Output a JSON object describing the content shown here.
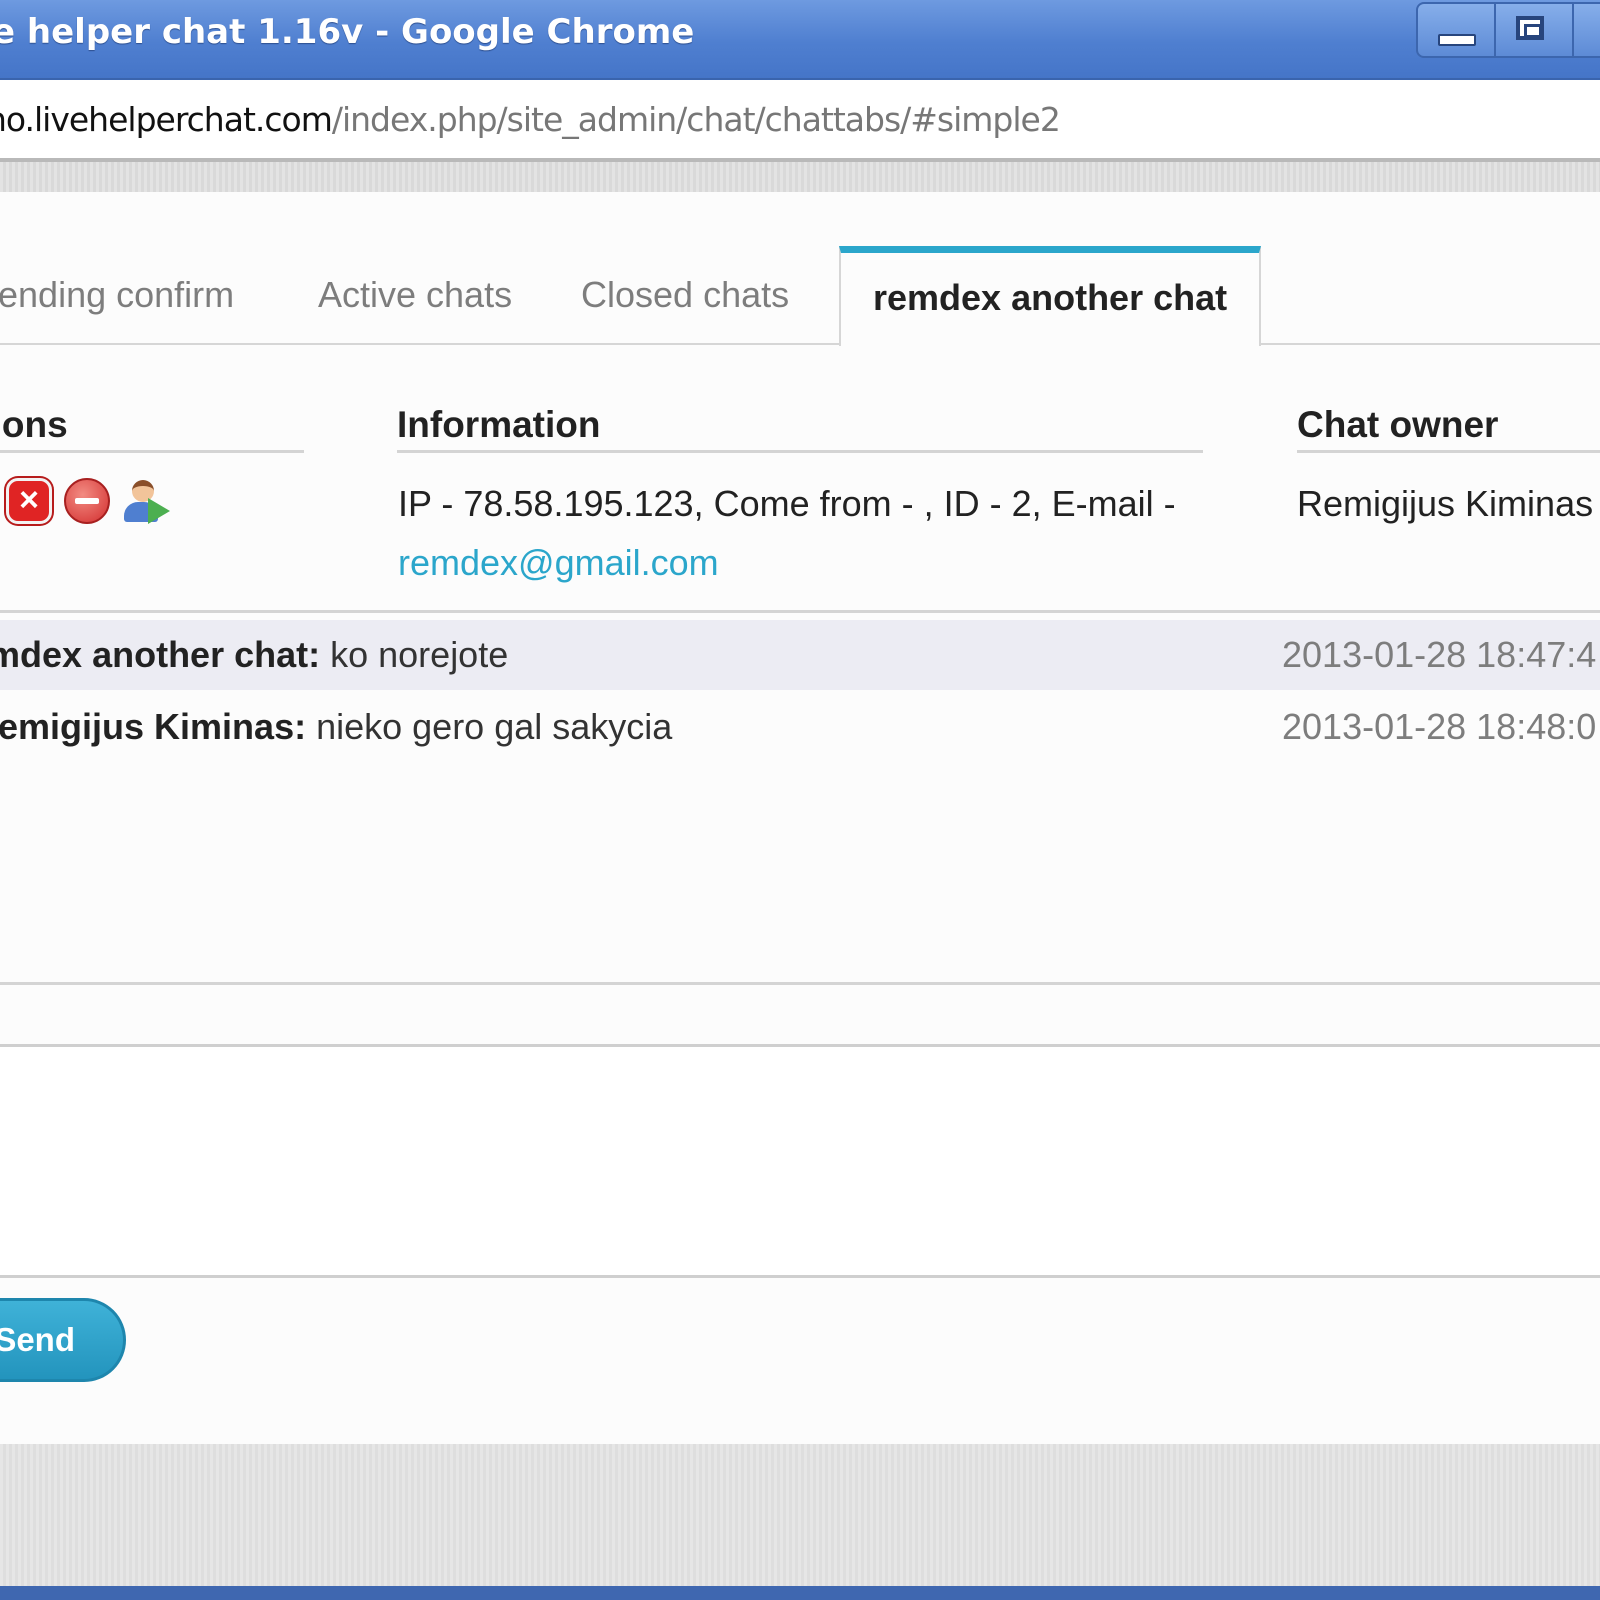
{
  "window": {
    "title": "e helper chat 1.16v - Google Chrome"
  },
  "address_bar": {
    "host": "no.livehelperchat.com",
    "path": "/index.php/site_admin/chat/chattabs/#simple2"
  },
  "tabs": [
    {
      "label": "Pending confirm",
      "active": false
    },
    {
      "label": "Active chats",
      "active": false
    },
    {
      "label": "Closed chats",
      "active": false
    },
    {
      "label": "remdex another chat",
      "active": true
    }
  ],
  "columns": {
    "actions": "Actions",
    "information": "Information",
    "owner": "Chat owner"
  },
  "chat_info": {
    "action_icons": [
      "close-chat-icon",
      "block-user-icon",
      "transfer-chat-icon"
    ],
    "info_prefix": "IP - 78.58.195.123, Come from - , ID - 2, E-mail -",
    "email": "remdex@gmail.com",
    "owner": "Remigijus Kiminas"
  },
  "messages": [
    {
      "author": "remdex another chat:",
      "text": " ko norejote",
      "time": "2013-01-28 18:47:4"
    },
    {
      "author": "Remigijus Kiminas:",
      "text": " nieko gero gal sakycia",
      "time": "2013-01-28 18:48:0"
    }
  ],
  "composer": {
    "send_label": "Send"
  },
  "colors": {
    "accent": "#2ba6cb",
    "titlebar": "#5a88d6",
    "close_icon": "#e02424",
    "alt_row": "#ececf3"
  }
}
